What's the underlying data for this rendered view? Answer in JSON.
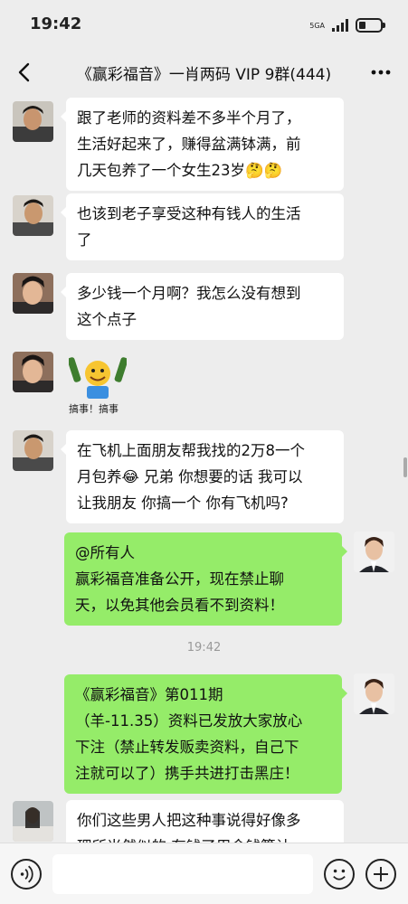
{
  "status_bar": {
    "time": "19:42",
    "network": "5GA",
    "battery_level": 0.3
  },
  "header": {
    "title": "《赢彩福音》一肖两码 VIP 9群(444)"
  },
  "messages": [
    {
      "side": "left",
      "lines": [
        "跟了老师的资料差不多半个月了，",
        "生活好起来了，赚得盆满钵满，前",
        "几天包养了一个女生23岁🤔🤔"
      ]
    },
    {
      "side": "left",
      "lines": [
        "也该到老子享受这种有钱人的生活",
        "了"
      ]
    },
    {
      "side": "left",
      "lines": [
        "多少钱一个月啊？我怎么没有想到",
        "这个点子"
      ]
    },
    {
      "side": "left",
      "sticker_caption": "搞事！搞事"
    },
    {
      "side": "left",
      "lines": [
        "在飞机上面朋友帮我找的2万8一个",
        "月包养😂 兄弟 你想要的话 我可以",
        "让我朋友 你搞一个 你有飞机吗?"
      ]
    },
    {
      "side": "right",
      "lines": [
        "@所有人",
        "赢彩福音准备公开，现在禁止聊",
        "天，以免其他会员看不到资料！"
      ]
    },
    {
      "timestamp": "19:42"
    },
    {
      "side": "right",
      "lines": [
        "《赢彩福音》第011期",
        "（羊-11.35）资料已发放大家放心",
        "下注（禁止转发贩卖资料，自己下",
        "注就可以了）携手共进打击黑庄！"
      ]
    },
    {
      "side": "left",
      "lines": [
        "你们这些男人把这种事说得好像多",
        "理所当然似的 有钱了用金钱算计"
      ]
    }
  ],
  "input_bar": {
    "placeholder": ""
  },
  "icons": [
    "back-arrow-icon",
    "more-dots-icon",
    "voice-icon",
    "emoji-face-icon",
    "plus-icon"
  ],
  "colors": {
    "background": "#ededed",
    "sent_bubble": "#95ec69",
    "received_bubble": "#ffffff"
  }
}
